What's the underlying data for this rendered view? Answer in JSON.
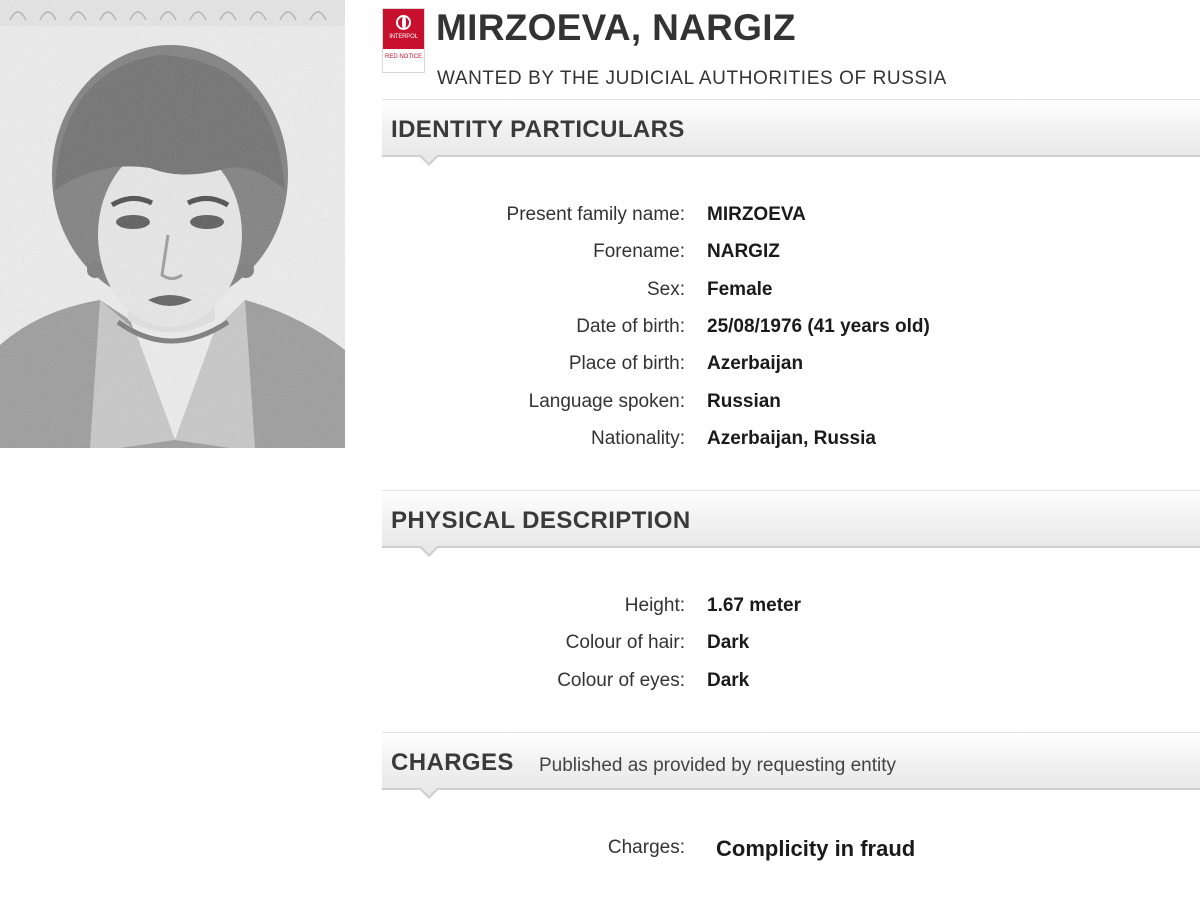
{
  "header": {
    "name": "MIRZOEVA, NARGIZ",
    "subtitle": "WANTED BY THE JUDICIAL AUTHORITIES OF RUSSIA",
    "logo_text": "INTERPOL",
    "notice_text": "RED NOTICE"
  },
  "identity": {
    "title": "IDENTITY PARTICULARS",
    "fields": [
      {
        "label": "Present family name:",
        "value": "MIRZOEVA"
      },
      {
        "label": "Forename:",
        "value": "NARGIZ"
      },
      {
        "label": "Sex:",
        "value": "Female"
      },
      {
        "label": "Date of birth:",
        "value": "25/08/1976 (41 years old)"
      },
      {
        "label": "Place of birth:",
        "value": "Azerbaijan"
      },
      {
        "label": "Language spoken:",
        "value": "Russian"
      },
      {
        "label": "Nationality:",
        "value": "Azerbaijan, Russia"
      }
    ]
  },
  "physical": {
    "title": "PHYSICAL DESCRIPTION",
    "fields": [
      {
        "label": "Height:",
        "value": "1.67 meter"
      },
      {
        "label": "Colour of hair:",
        "value": "Dark"
      },
      {
        "label": "Colour of eyes:",
        "value": "Dark"
      }
    ]
  },
  "charges": {
    "title": "CHARGES",
    "subtitle": "Published as provided by requesting entity",
    "fields": [
      {
        "label": "Charges:",
        "value": "Complicity in fraud"
      }
    ]
  },
  "colors": {
    "brand_red": "#c8102e",
    "header_text": "#333333"
  }
}
